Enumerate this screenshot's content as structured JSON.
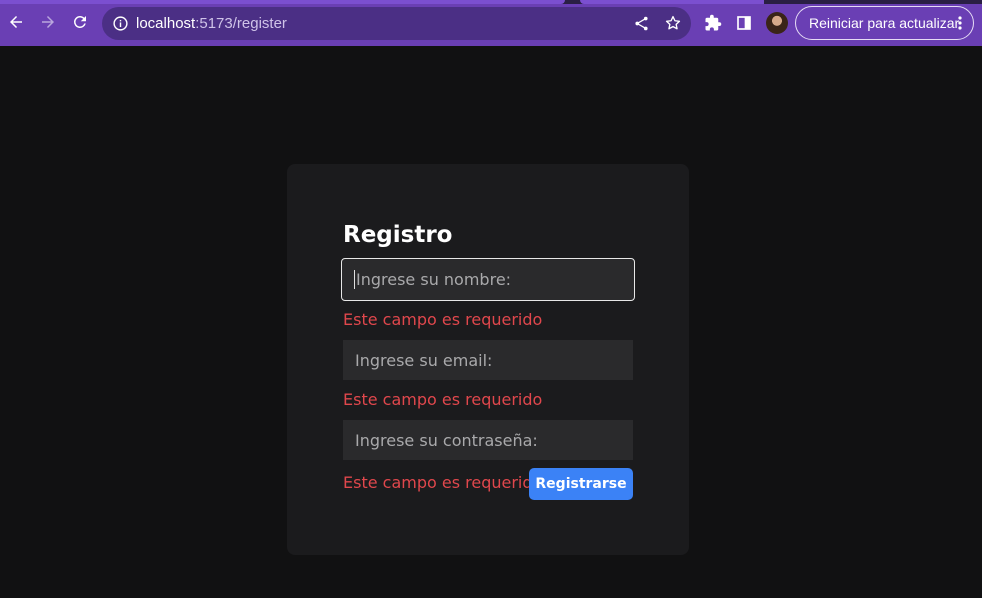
{
  "browser": {
    "url_host": "localhost",
    "url_path": ":5173/register",
    "update_button_label": "Reiniciar para actualizar",
    "icons": [
      "back-icon",
      "forward-icon",
      "reload-icon",
      "info-icon",
      "share-icon",
      "star-icon",
      "extensions-icon",
      "side-panel-icon",
      "kebab-menu-icon"
    ]
  },
  "form": {
    "title": "Registro",
    "name_placeholder": "Ingrese su nombre:",
    "email_placeholder": "Ingrese su email:",
    "password_placeholder": "Ingrese su contraseña:",
    "name_error": "Este campo es requerido",
    "email_error": "Este campo es requerido",
    "password_error": "Este campo es requerido",
    "submit_label": "Registrarse"
  },
  "colors": {
    "chrome": "#6a3fb4",
    "page_background": "#111112",
    "card_background": "#1b1b1d",
    "error": "#e0474c",
    "primary_button": "#3b82f6"
  }
}
